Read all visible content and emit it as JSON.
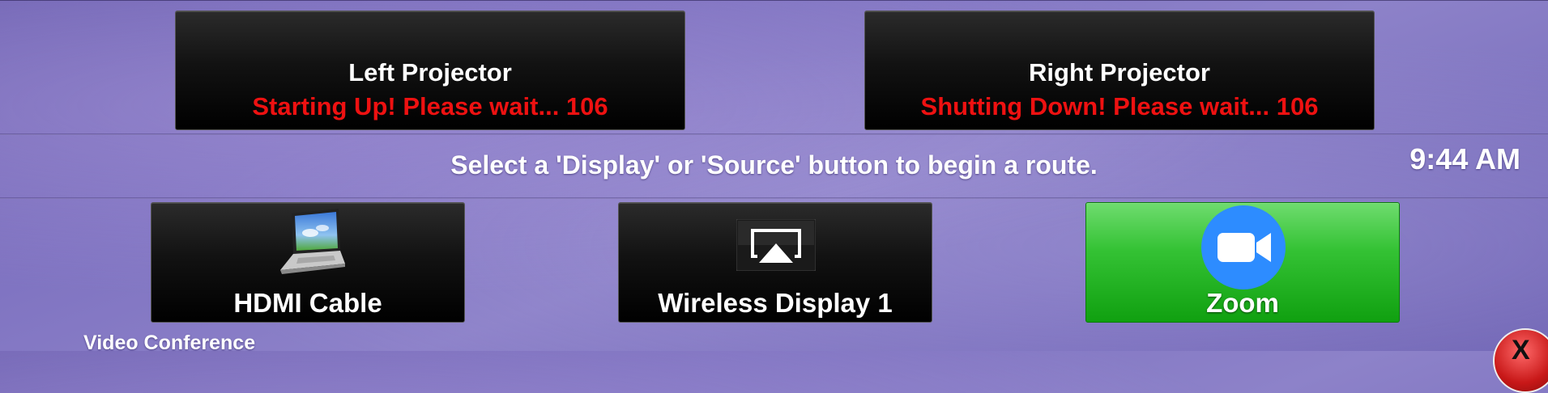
{
  "displays": {
    "left": {
      "title": "Left Projector",
      "status": "Starting Up!  Please wait... 106"
    },
    "right": {
      "title": "Right Projector",
      "status": "Shutting Down! Please wait... 106"
    }
  },
  "prompt": "Select a 'Display' or 'Source' button to begin a route.",
  "clock": "9:44 AM",
  "sources": [
    {
      "label": "HDMI Cable",
      "icon": "laptop-icon"
    },
    {
      "label": "Wireless Display 1",
      "icon": "airplay-icon"
    },
    {
      "label": "Zoom",
      "icon": "zoom-camera-icon",
      "selected": true
    }
  ],
  "footer": {
    "label": "Video Conference"
  },
  "close": {
    "glyph": "X"
  },
  "colors": {
    "status_red": "#ee1111",
    "zoom_green": "#22b022",
    "zoom_blue": "#2d8cff"
  }
}
